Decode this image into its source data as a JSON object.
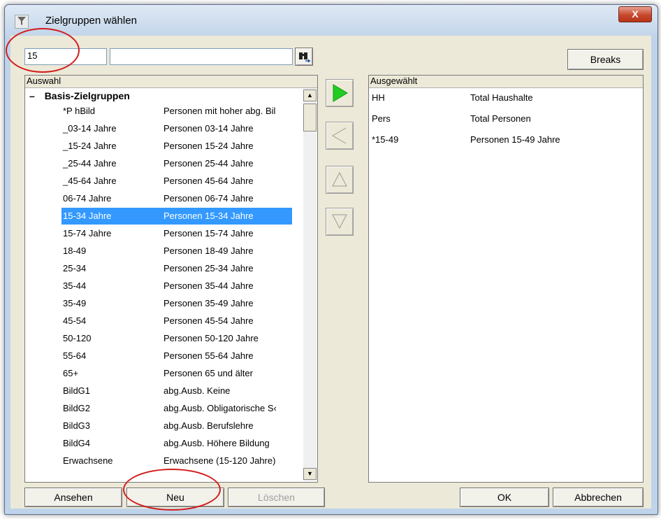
{
  "window": {
    "title": "Zielgruppen wählen",
    "close_glyph": "X"
  },
  "search": {
    "value": "15",
    "secondary_value": ""
  },
  "buttons": {
    "breaks": "Breaks",
    "ansehen": "Ansehen",
    "neu": "Neu",
    "loeschen": "Löschen",
    "ok": "OK",
    "abbrechen": "Abbrechen"
  },
  "left_panel": {
    "header": "Auswahl",
    "group": {
      "toggle": "–",
      "label": "Basis-Zielgruppen"
    },
    "items": [
      {
        "code": "*P hBild",
        "desc": "Personen mit hoher abg. Bil"
      },
      {
        "code": "_03-14 Jahre",
        "desc": "Personen 03-14 Jahre"
      },
      {
        "code": "_15-24 Jahre",
        "desc": "Personen 15-24 Jahre"
      },
      {
        "code": "_25-44 Jahre",
        "desc": "Personen 25-44 Jahre"
      },
      {
        "code": "_45-64 Jahre",
        "desc": "Personen 45-64 Jahre"
      },
      {
        "code": "06-74 Jahre",
        "desc": "Personen 06-74 Jahre"
      },
      {
        "code": "15-34 Jahre",
        "desc": "Personen 15-34 Jahre",
        "selected": true
      },
      {
        "code": "15-74 Jahre",
        "desc": "Personen 15-74 Jahre"
      },
      {
        "code": "18-49",
        "desc": "Personen 18-49 Jahre"
      },
      {
        "code": "25-34",
        "desc": "Personen 25-34 Jahre"
      },
      {
        "code": "35-44",
        "desc": "Personen 35-44 Jahre"
      },
      {
        "code": "35-49",
        "desc": "Personen 35-49 Jahre"
      },
      {
        "code": "45-54",
        "desc": "Personen 45-54 Jahre"
      },
      {
        "code": "50-120",
        "desc": "Personen 50-120 Jahre"
      },
      {
        "code": "55-64",
        "desc": "Personen 55-64 Jahre"
      },
      {
        "code": "65+",
        "desc": "Personen 65 und älter"
      },
      {
        "code": "BildG1",
        "desc": "abg.Ausb. Keine"
      },
      {
        "code": "BildG2",
        "desc": "abg.Ausb. Obligatorische S‹"
      },
      {
        "code": "BildG3",
        "desc": "abg.Ausb. Berufslehre"
      },
      {
        "code": "BildG4",
        "desc": "abg.Ausb. Höhere Bildung"
      },
      {
        "code": "Erwachsene",
        "desc": "Erwachsene (15-120 Jahre)"
      }
    ]
  },
  "right_panel": {
    "header": "Ausgewählt",
    "items": [
      {
        "code": "HH",
        "desc": "Total Haushalte"
      },
      {
        "code": "Pers",
        "desc": "Total Personen"
      },
      {
        "code": "*15-49",
        "desc": "Personen 15-49 Jahre"
      }
    ]
  },
  "icons": {
    "title": "filter-icon",
    "search": "binoculars-icon",
    "add": "play-arrow-icon",
    "remove": "left-arrow-icon",
    "up": "up-arrow-icon",
    "down": "down-arrow-icon"
  },
  "colors": {
    "selection": "#3399ff",
    "add_arrow": "#22cc22",
    "annotation": "#d21c1c"
  }
}
